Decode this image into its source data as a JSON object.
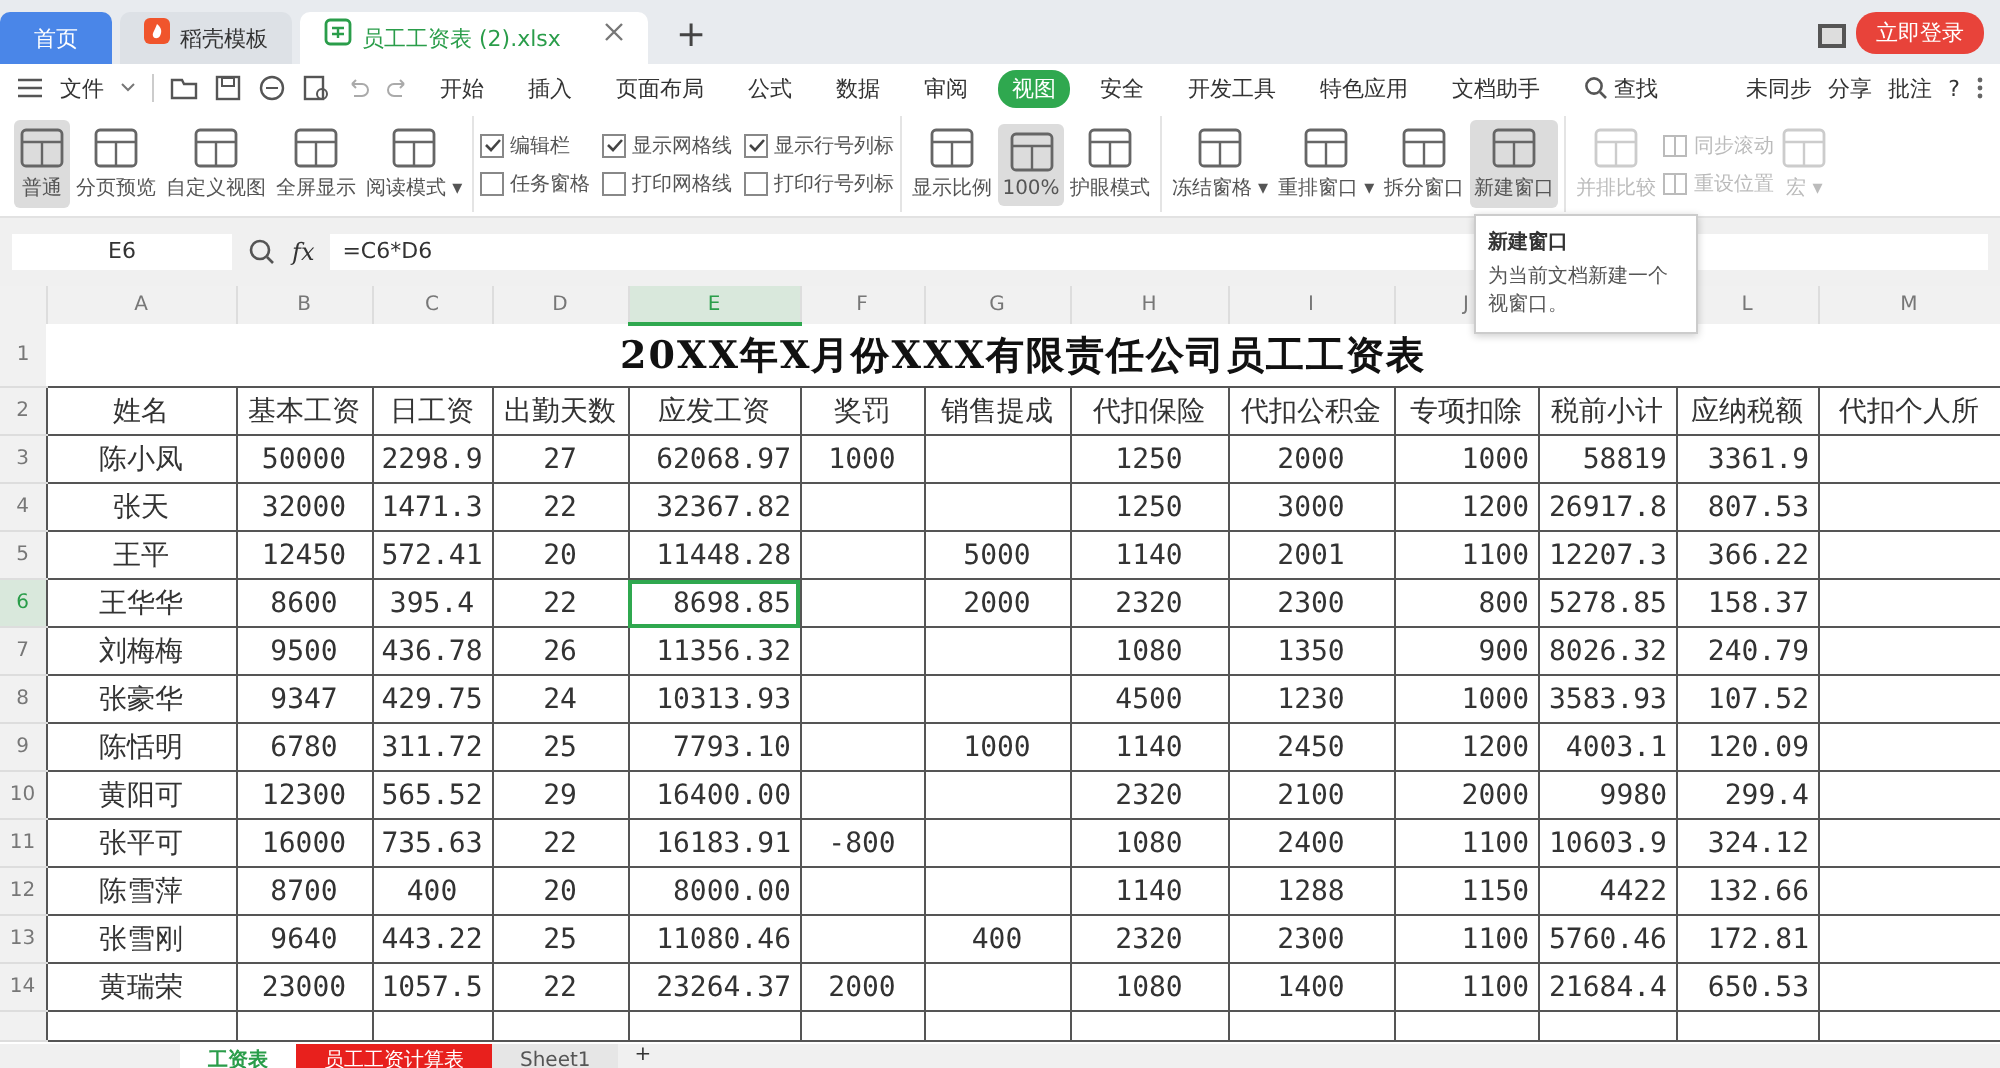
{
  "doc_tabs": [
    {
      "kind": "home",
      "label": "首页",
      "selected": false
    },
    {
      "kind": "template",
      "label": "稻壳模板",
      "selected": false
    },
    {
      "kind": "file",
      "label": "员工工资表 (2).xlsx",
      "selected": true
    }
  ],
  "new_tab": "+",
  "login_button": "立即登录",
  "menu": {
    "file": "文件",
    "tabs": [
      {
        "label": "开始",
        "selected": false
      },
      {
        "label": "插入",
        "selected": false
      },
      {
        "label": "页面布局",
        "selected": false
      },
      {
        "label": "公式",
        "selected": false
      },
      {
        "label": "数据",
        "selected": false
      },
      {
        "label": "审阅",
        "selected": false
      },
      {
        "label": "视图",
        "selected": true
      },
      {
        "label": "安全",
        "selected": false
      },
      {
        "label": "开发工具",
        "selected": false
      },
      {
        "label": "特色应用",
        "selected": false
      },
      {
        "label": "文档助手",
        "selected": false
      }
    ],
    "search": "查找",
    "right": [
      "未同步",
      "分享",
      "批注"
    ],
    "help": "?"
  },
  "ribbon": [
    [
      {
        "kind": "button",
        "label": "普通",
        "selected": true,
        "disabled": false
      },
      {
        "kind": "button",
        "label": "分页预览",
        "selected": false,
        "disabled": false
      },
      {
        "kind": "button",
        "label": "自定义视图",
        "selected": false,
        "disabled": false
      },
      {
        "kind": "button",
        "label": "全屏显示",
        "selected": false,
        "disabled": false
      },
      {
        "kind": "button",
        "label": "阅读模式 ▾",
        "selected": false,
        "disabled": false
      }
    ],
    [
      {
        "kind": "checkbox",
        "label": "编辑栏",
        "checked": true
      },
      {
        "kind": "checkbox",
        "label": "任务窗格",
        "checked": false
      },
      {
        "kind": "checkbox",
        "label": "显示网格线",
        "checked": true
      },
      {
        "kind": "checkbox",
        "label": "打印网格线",
        "checked": false
      },
      {
        "kind": "checkbox",
        "label": "显示行号列标",
        "checked": true
      },
      {
        "kind": "checkbox",
        "label": "打印行号列标",
        "checked": false
      }
    ],
    [
      {
        "kind": "button",
        "label": "显示比例",
        "selected": false,
        "disabled": false
      },
      {
        "kind": "button",
        "label": "100%",
        "selected": true,
        "disabled": false
      },
      {
        "kind": "button",
        "label": "护眼模式",
        "selected": false,
        "disabled": false
      }
    ],
    [
      {
        "kind": "button",
        "label": "冻结窗格 ▾",
        "selected": false,
        "disabled": false
      },
      {
        "kind": "button",
        "label": "重排窗口 ▾",
        "selected": false,
        "disabled": false
      },
      {
        "kind": "button",
        "label": "拆分窗口",
        "selected": false,
        "disabled": false
      },
      {
        "kind": "button",
        "label": "新建窗口",
        "selected": true,
        "disabled": false
      }
    ],
    [
      {
        "kind": "button",
        "label": "并排比较",
        "selected": false,
        "disabled": true
      },
      {
        "kind": "small",
        "label": "同步滚动",
        "disabled": true
      },
      {
        "kind": "small",
        "label": "重设位置",
        "disabled": true
      },
      {
        "kind": "button",
        "label": "宏 ▾",
        "selected": false,
        "disabled": true
      }
    ]
  ],
  "tooltip": {
    "title": "新建窗口",
    "text": "为当前文档新建一个视窗口。"
  },
  "name_box": "E6",
  "function_label": "fx",
  "formula": "=C6*D6",
  "columns": [
    {
      "label": "A",
      "selected": false
    },
    {
      "label": "B",
      "selected": false
    },
    {
      "label": "C",
      "selected": false
    },
    {
      "label": "D",
      "selected": false
    },
    {
      "label": "E",
      "selected": true
    },
    {
      "label": "F",
      "selected": false
    },
    {
      "label": "G",
      "selected": false
    },
    {
      "label": "H",
      "selected": false
    },
    {
      "label": "I",
      "selected": false
    },
    {
      "label": "J",
      "selected": false
    },
    {
      "label": "L",
      "selected": false
    },
    {
      "label": "M",
      "selected": false
    }
  ],
  "title_row": {
    "number": "1",
    "title": "20XX年X月份XXX有限责任公司员工工资表"
  },
  "header_row": {
    "number": "2",
    "cells": [
      "姓名",
      "基本工资",
      "日工资",
      "出勤天数",
      "应发工资",
      "奖罚",
      "销售提成",
      "代扣保险",
      "代扣公积金",
      "专项扣除",
      "税前小计",
      "应纳税额",
      "代扣个人所"
    ]
  },
  "rows": [
    {
      "number": "3",
      "selected": false,
      "cells": [
        "陈小凤",
        "50000",
        "2298.9",
        "27",
        "62068.97",
        "1000",
        "",
        "1250",
        "2000",
        "1000",
        "58819",
        "3361.9",
        ""
      ]
    },
    {
      "number": "4",
      "selected": false,
      "cells": [
        "张天",
        "32000",
        "1471.3",
        "22",
        "32367.82",
        "",
        "",
        "1250",
        "3000",
        "1200",
        "26917.8",
        "807.53",
        ""
      ]
    },
    {
      "number": "5",
      "selected": false,
      "cells": [
        "王平",
        "12450",
        "572.41",
        "20",
        "11448.28",
        "",
        "5000",
        "1140",
        "2001",
        "1100",
        "12207.3",
        "366.22",
        ""
      ]
    },
    {
      "number": "6",
      "selected": true,
      "cells": [
        "王华华",
        "8600",
        "395.4",
        "22",
        "8698.85",
        "",
        "2000",
        "2320",
        "2300",
        "800",
        "5278.85",
        "158.37",
        ""
      ]
    },
    {
      "number": "7",
      "selected": false,
      "cells": [
        "刘梅梅",
        "9500",
        "436.78",
        "26",
        "11356.32",
        "",
        "",
        "1080",
        "1350",
        "900",
        "8026.32",
        "240.79",
        ""
      ]
    },
    {
      "number": "8",
      "selected": false,
      "cells": [
        "张豪华",
        "9347",
        "429.75",
        "24",
        "10313.93",
        "",
        "",
        "4500",
        "1230",
        "1000",
        "3583.93",
        "107.52",
        ""
      ]
    },
    {
      "number": "9",
      "selected": false,
      "cells": [
        "陈恬明",
        "6780",
        "311.72",
        "25",
        "7793.10",
        "",
        "1000",
        "1140",
        "2450",
        "1200",
        "4003.1",
        "120.09",
        ""
      ]
    },
    {
      "number": "10",
      "selected": false,
      "cells": [
        "黄阳可",
        "12300",
        "565.52",
        "29",
        "16400.00",
        "",
        "",
        "2320",
        "2100",
        "2000",
        "9980",
        "299.4",
        ""
      ]
    },
    {
      "number": "11",
      "selected": false,
      "cells": [
        "张平可",
        "16000",
        "735.63",
        "22",
        "16183.91",
        "-800",
        "",
        "1080",
        "2400",
        "1100",
        "10603.9",
        "324.12",
        ""
      ]
    },
    {
      "number": "12",
      "selected": false,
      "cells": [
        "陈雪萍",
        "8700",
        "400",
        "20",
        "8000.00",
        "",
        "",
        "1140",
        "1288",
        "1150",
        "4422",
        "132.66",
        ""
      ]
    },
    {
      "number": "13",
      "selected": false,
      "cells": [
        "张雪刚",
        "9640",
        "443.22",
        "25",
        "11080.46",
        "",
        "400",
        "2320",
        "2300",
        "1100",
        "5760.46",
        "172.81",
        ""
      ]
    },
    {
      "number": "14",
      "selected": false,
      "cells": [
        "黄瑞荣",
        "23000",
        "1057.5",
        "22",
        "23264.37",
        "2000",
        "",
        "1080",
        "1400",
        "1100",
        "21684.4",
        "650.53",
        ""
      ]
    }
  ],
  "sheet_tabs": [
    {
      "label": "工资表",
      "selected": true,
      "color": "#ffffff"
    },
    {
      "label": "员工工资计算表",
      "selected": false,
      "color": "#e8201d"
    },
    {
      "label": "Sheet1",
      "selected": false,
      "color": "#e6e6e6"
    }
  ],
  "add_sheet": "+"
}
